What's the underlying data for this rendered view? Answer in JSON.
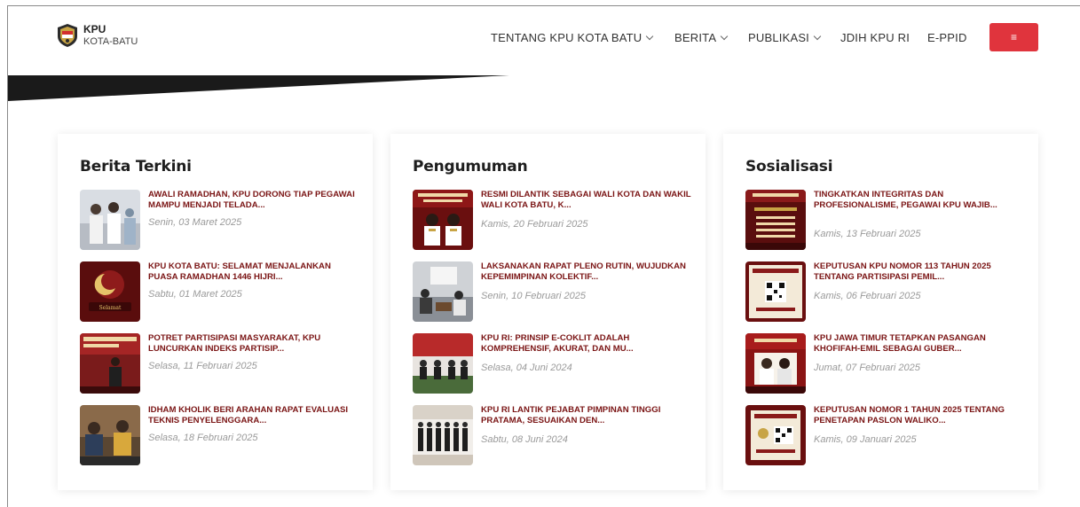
{
  "brand": {
    "name": "KPU",
    "subtitle": "KOTA-BATU"
  },
  "nav": {
    "items": [
      {
        "label": "TENTANG KPU KOTA BATU",
        "dropdown": true
      },
      {
        "label": "BERITA",
        "dropdown": true
      },
      {
        "label": "PUBLIKASI",
        "dropdown": true
      },
      {
        "label": "JDIH KPU RI",
        "dropdown": false
      },
      {
        "label": "E-PPID",
        "dropdown": false
      }
    ],
    "menu_button_icon": "≡"
  },
  "colors": {
    "accent": "#e0343d",
    "news_title": "#7a1414",
    "date": "#9a9a9a",
    "banner": "#1a1a1a"
  },
  "sections": [
    {
      "title": "Berita Terkini",
      "items": [
        {
          "title": "AWALI RAMADHAN, KPU DORONG TIAP PEGAWAI MAMPU MENJADI TELADA...",
          "date": "Senin, 03 Maret 2025"
        },
        {
          "title": "KPU KOTA BATU: SELAMAT MENJALANKAN PUASA RAMADHAN 1446 HIJRI...",
          "date": "Sabtu, 01 Maret 2025"
        },
        {
          "title": "POTRET PARTISIPASI MASYARAKAT, KPU LUNCURKAN INDEKS PARTISIP...",
          "date": "Selasa, 11 Februari 2025"
        },
        {
          "title": "IDHAM KHOLIK BERI ARAHAN RAPAT EVALUASI TEKNIS PENYELENGGARA...",
          "date": "Selasa, 18 Februari 2025"
        }
      ]
    },
    {
      "title": "Pengumuman",
      "items": [
        {
          "title": "RESMI DILANTIK SEBAGAI WALI KOTA DAN WAKIL WALI KOTA BATU, K...",
          "date": "Kamis, 20 Februari 2025"
        },
        {
          "title": "LAKSANAKAN RAPAT PLENO RUTIN, WUJUDKAN KEPEMIMPINAN KOLEKTIF...",
          "date": "Senin, 10 Februari 2025"
        },
        {
          "title": "KPU RI: PRINSIP E-COKLIT ADALAH KOMPREHENSIF, AKURAT, DAN MU...",
          "date": "Selasa, 04 Juni 2024"
        },
        {
          "title": "KPU RI LANTIK PEJABAT PIMPINAN TINGGI PRATAMA, SESUAIKAN DEN...",
          "date": "Sabtu, 08 Juni 2024"
        }
      ]
    },
    {
      "title": "Sosialisasi",
      "items": [
        {
          "title": "TINGKATKAN INTEGRITAS DAN PROFESIONALISME, PEGAWAI KPU WAJIB...",
          "date": "Kamis, 13 Februari 2025"
        },
        {
          "title": "KEPUTUSAN KPU NOMOR 113 TAHUN 2025 TENTANG PARTISIPASI PEMIL...",
          "date": "Kamis, 06 Februari 2025"
        },
        {
          "title": "KPU JAWA TIMUR TETAPKAN PASANGAN KHOFIFAH-EMIL SEBAGAI GUBER...",
          "date": "Jumat, 07 Februari 2025"
        },
        {
          "title": "KEPUTUSAN NOMOR 1 TAHUN 2025 TENTANG PENETAPAN PASLON WALIKO...",
          "date": "Kamis, 09 Januari 2025"
        }
      ]
    }
  ]
}
